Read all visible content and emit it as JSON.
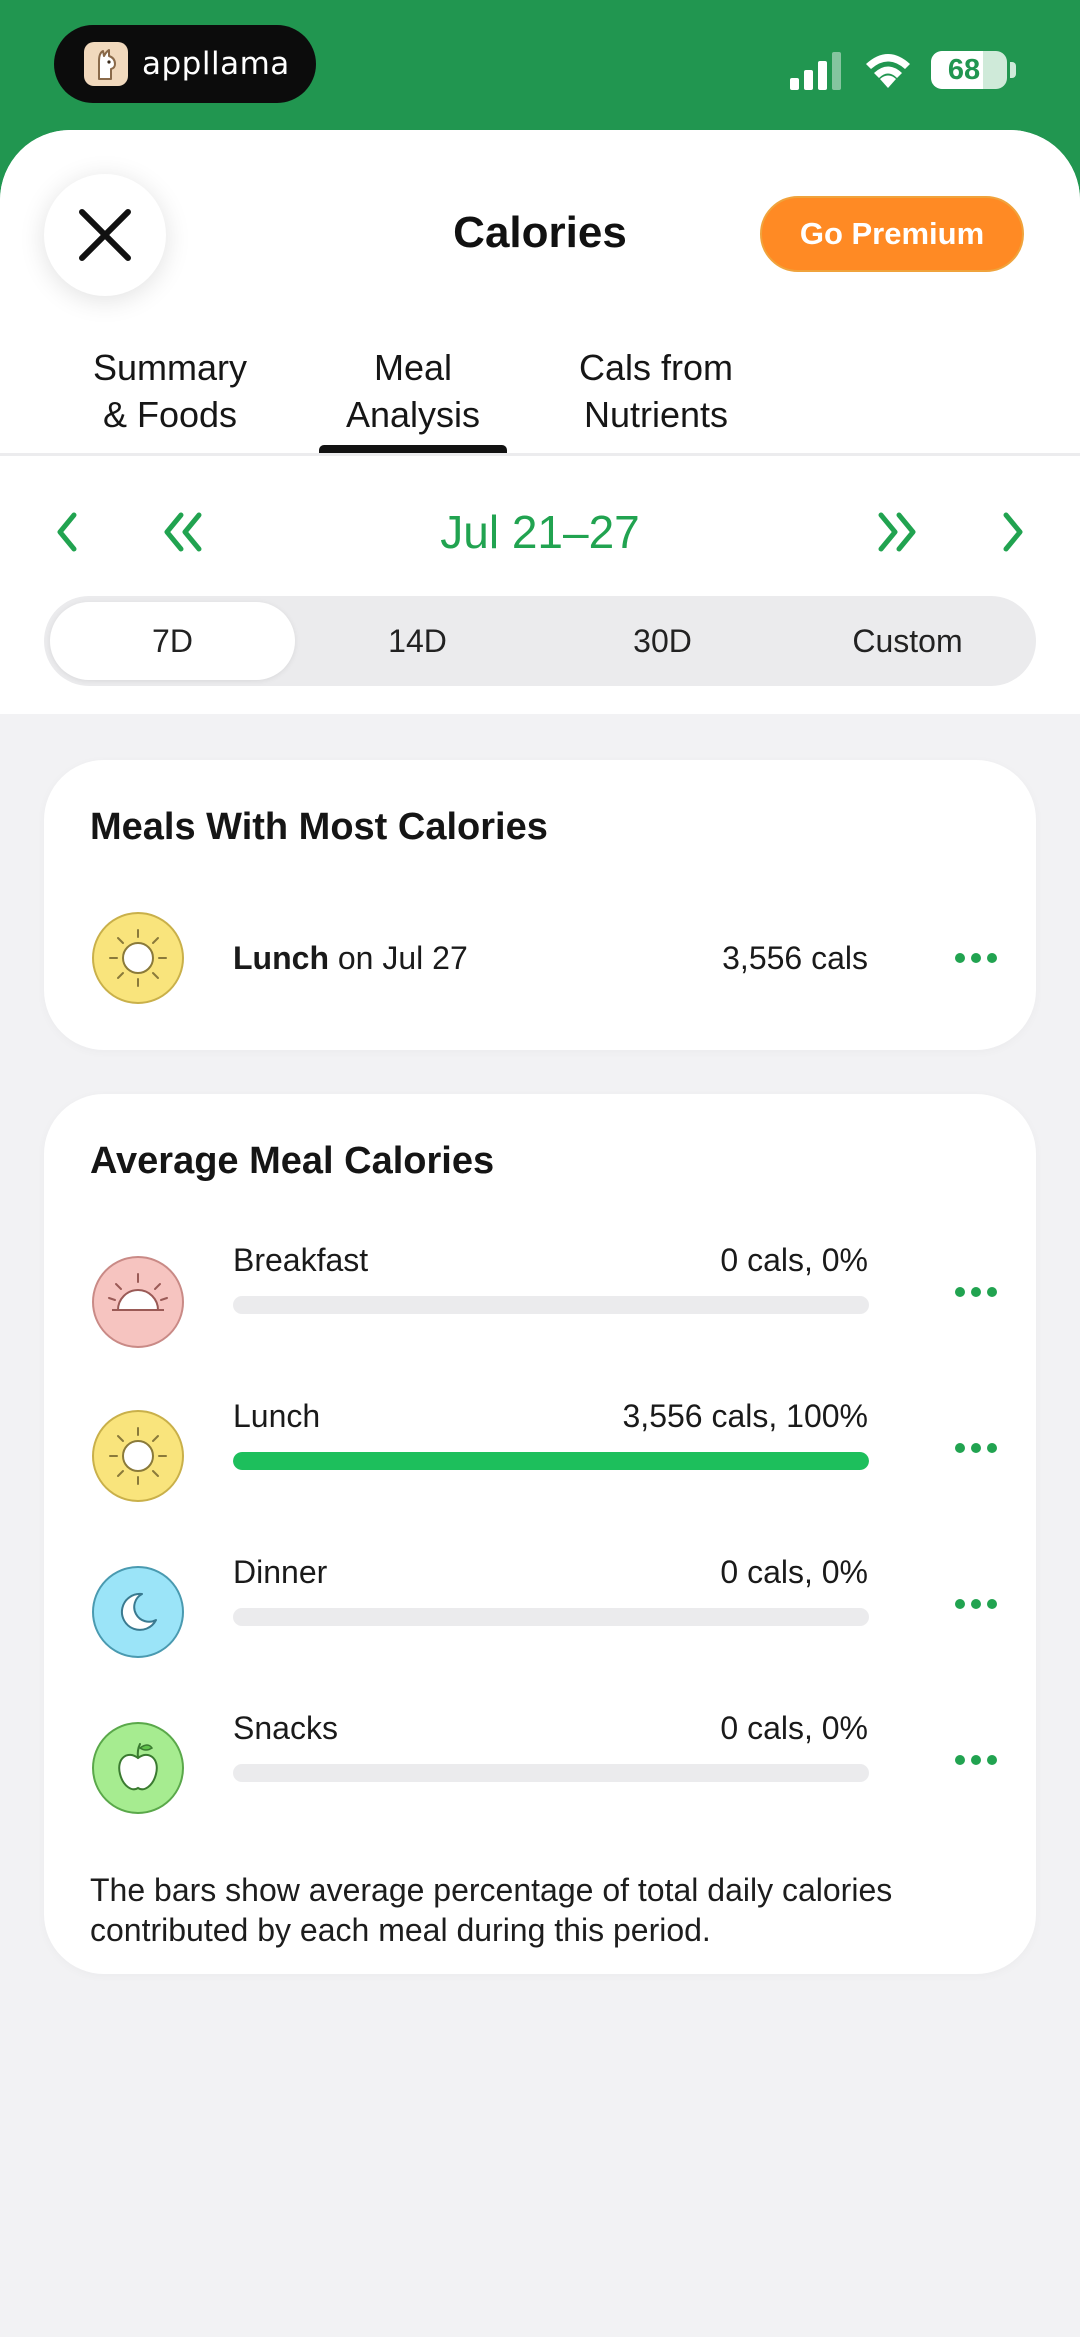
{
  "status_bar": {
    "app_name": "appllama",
    "battery": "68",
    "battery_level": 0.68
  },
  "header": {
    "close_icon": "close-icon",
    "title": "Calories",
    "premium_label": "Go Premium"
  },
  "tabs": [
    {
      "line1": "Summary",
      "line2": "& Foods"
    },
    {
      "line1": "Meal",
      "line2": "Analysis",
      "active": true
    },
    {
      "line1": "Cals from",
      "line2": "Nutrients"
    }
  ],
  "date_nav": {
    "range": "Jul 21–27",
    "icons": [
      "chevron-left-icon",
      "double-chevron-left-icon",
      "double-chevron-right-icon",
      "chevron-right-icon"
    ]
  },
  "periods": [
    {
      "label": "7D",
      "active": true
    },
    {
      "label": "14D"
    },
    {
      "label": "30D"
    },
    {
      "label": "Custom"
    }
  ],
  "most_calories": {
    "title": "Meals With Most Calories",
    "meal": "Lunch",
    "date_text": " on Jul 27",
    "value": "3,556 cals",
    "icon": "sun-icon"
  },
  "average": {
    "title": "Average Meal Calories",
    "meals": [
      {
        "name": "Breakfast",
        "value": "0 cals, 0%",
        "percent": 0,
        "icon": "sunrise-icon",
        "color": "#f6c4c0"
      },
      {
        "name": "Lunch",
        "value": "3,556 cals, 100%",
        "percent": 100,
        "icon": "sun-icon",
        "color": "#f9e47c"
      },
      {
        "name": "Dinner",
        "value": "0 cals, 0%",
        "percent": 0,
        "icon": "moon-icon",
        "color": "#9be4f8"
      },
      {
        "name": "Snacks",
        "value": "0 cals, 0%",
        "percent": 0,
        "icon": "apple-icon",
        "color": "#a6ec90"
      }
    ],
    "footnote": "The bars show average percentage of total daily calories contributed by each meal during this period."
  },
  "colors": {
    "brand_green": "#219650",
    "accent_green": "#21a350",
    "bar_green": "#1dbf5c",
    "premium_orange": "#ff8a24"
  }
}
